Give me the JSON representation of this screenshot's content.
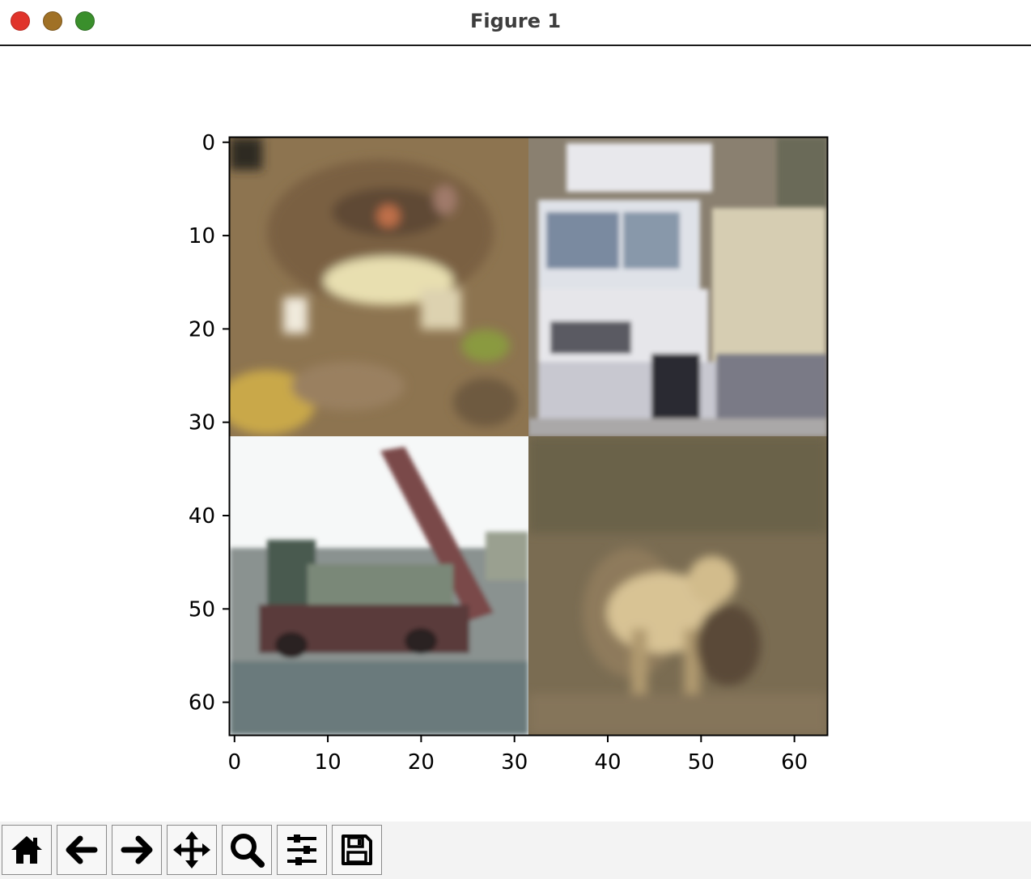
{
  "window": {
    "title": "Figure 1",
    "controls": [
      "close",
      "minimize",
      "maximize"
    ]
  },
  "chart_data": {
    "type": "image",
    "description_of_content": "2x2 grid of 32x32 images",
    "grid": {
      "rows": 2,
      "cols": 2,
      "tile_size": 32
    },
    "xlim": [
      -0.5,
      63.5
    ],
    "ylim": [
      63.5,
      -0.5
    ],
    "xticks": [
      0,
      10,
      20,
      30,
      40,
      50,
      60
    ],
    "yticks": [
      0,
      10,
      20,
      30,
      40,
      50,
      60
    ],
    "xtick_labels": [
      "0",
      "10",
      "20",
      "30",
      "40",
      "50",
      "60"
    ],
    "ytick_labels": [
      "0",
      "10",
      "20",
      "30",
      "40",
      "50",
      "60"
    ]
  },
  "toolbar": {
    "buttons": [
      {
        "name": "home",
        "icon": "home-icon"
      },
      {
        "name": "back",
        "icon": "arrow-left-icon"
      },
      {
        "name": "forward",
        "icon": "arrow-right-icon"
      },
      {
        "name": "pan",
        "icon": "move-icon"
      },
      {
        "name": "zoom",
        "icon": "magnifier-icon"
      },
      {
        "name": "configure-subplots",
        "icon": "sliders-icon"
      },
      {
        "name": "save",
        "icon": "floppy-disk-icon"
      }
    ]
  }
}
